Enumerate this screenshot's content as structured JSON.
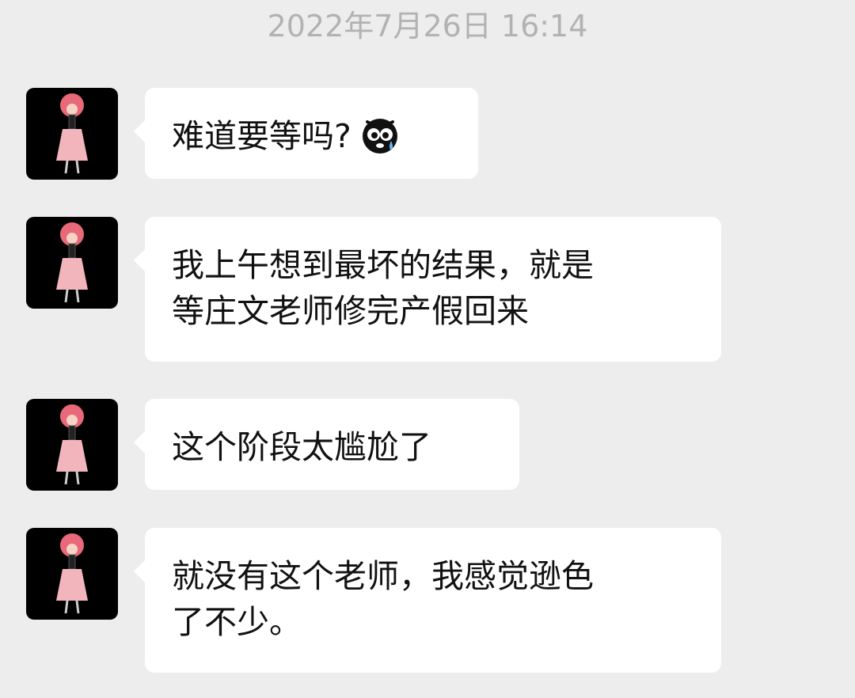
{
  "timestamp": "2022年7月26日 16:14",
  "messages": [
    {
      "lines": [
        "难道要等吗?"
      ],
      "emoji": "crying-face-emoji"
    },
    {
      "lines": [
        "我上午想到最坏的结果，就是",
        "等庄文老师修完产假回来"
      ]
    },
    {
      "lines": [
        "这个阶段太尴尬了"
      ]
    },
    {
      "lines": [
        "就没有这个老师，我感觉逊色",
        "了不少。"
      ]
    }
  ],
  "colors": {
    "background": "#ededed",
    "bubble": "#ffffff",
    "timestamp": "#b2b2b2",
    "avatar_bg": "#000000",
    "avatar_figure": "#f2a0a8"
  }
}
